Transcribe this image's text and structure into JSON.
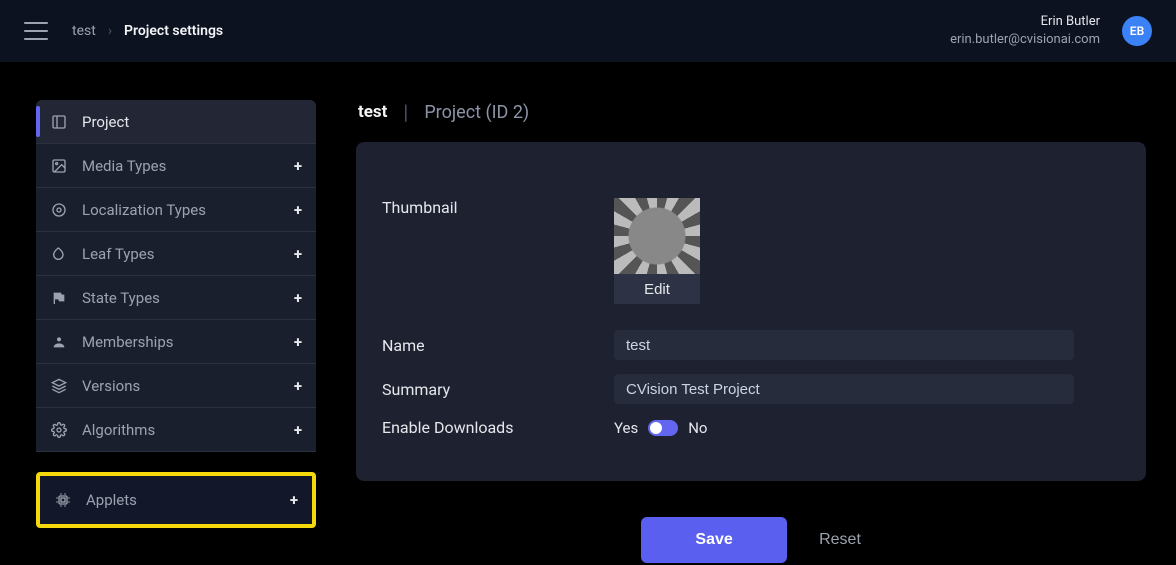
{
  "topbar": {
    "breadcrumb_link": "test",
    "breadcrumb_current": "Project settings",
    "user_name": "Erin Butler",
    "user_email": "erin.butler@cvisionai.com",
    "avatar_initials": "EB"
  },
  "sidebar": {
    "items": [
      {
        "label": "Project",
        "icon": "layout-icon",
        "has_plus": false,
        "active": true
      },
      {
        "label": "Media Types",
        "icon": "image-icon",
        "has_plus": true
      },
      {
        "label": "Localization Types",
        "icon": "target-icon",
        "has_plus": true
      },
      {
        "label": "Leaf Types",
        "icon": "leaf-icon",
        "has_plus": true
      },
      {
        "label": "State Types",
        "icon": "flag-icon",
        "has_plus": true
      },
      {
        "label": "Memberships",
        "icon": "user-icon",
        "has_plus": true
      },
      {
        "label": "Versions",
        "icon": "layers-icon",
        "has_plus": true
      },
      {
        "label": "Algorithms",
        "icon": "gear-icon",
        "has_plus": true
      }
    ],
    "highlighted": {
      "label": "Applets",
      "icon": "cpu-icon",
      "has_plus": true
    }
  },
  "content": {
    "header_name": "test",
    "header_sub": "Project (ID 2)",
    "thumbnail_label": "Thumbnail",
    "edit_label": "Edit",
    "name_label": "Name",
    "name_value": "test",
    "summary_label": "Summary",
    "summary_value": "CVision Test Project",
    "downloads_label": "Enable Downloads",
    "yes": "Yes",
    "no": "No",
    "save": "Save",
    "reset": "Reset"
  }
}
